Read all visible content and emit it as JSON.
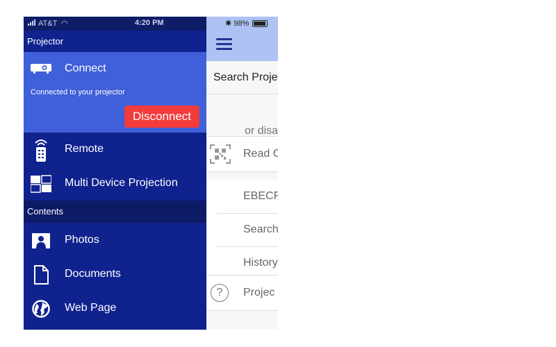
{
  "status": {
    "carrier": "AT&T",
    "time": "4:20 PM",
    "battery": "98%"
  },
  "drawer": {
    "section_projector": "Projector",
    "connect": {
      "label": "Connect",
      "status_text": "Connected to your projector",
      "disconnect_label": "Disconnect",
      "disconnect_color": "#f23b3b"
    },
    "remote_label": "Remote",
    "multi_label": "Multi Device Projection",
    "section_contents": "Contents",
    "photos_label": "Photos",
    "documents_label": "Documents",
    "webpage_label": "Web Page",
    "accent_color": "#4060d9",
    "background_color": "#10228e"
  },
  "background_screen": {
    "title": "Search Proje",
    "hint": "or disa",
    "read_label": "Read C",
    "items": [
      "EBECF",
      "Search",
      "History"
    ],
    "projector_label": "Projec",
    "header_color": "#aec3f3"
  }
}
